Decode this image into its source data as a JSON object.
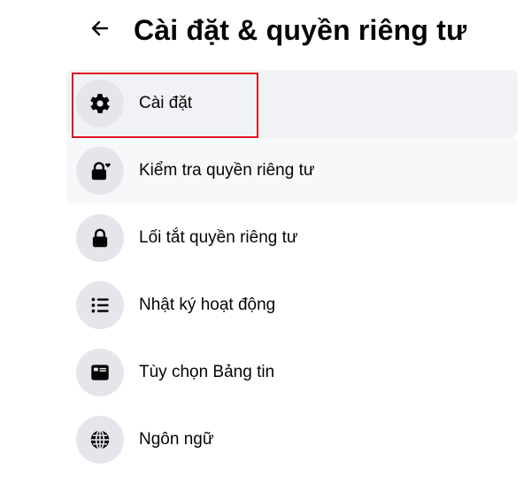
{
  "header": {
    "back_icon": "arrow-left-icon",
    "title": "Cài đặt & quyền riêng tư"
  },
  "menu": {
    "items": [
      {
        "label": "Cài đặt",
        "icon": "gear-icon"
      },
      {
        "label": "Kiểm tra quyền riêng tư",
        "icon": "lock-heart-icon"
      },
      {
        "label": "Lối tắt quyền riêng tư",
        "icon": "lock-icon"
      },
      {
        "label": "Nhật ký hoạt động",
        "icon": "list-icon"
      },
      {
        "label": "Tùy chọn Bảng tin",
        "icon": "news-feed-icon"
      },
      {
        "label": "Ngôn ngữ",
        "icon": "globe-icon"
      }
    ]
  },
  "colors": {
    "highlight_border": "#e0141e",
    "icon_background": "#e4e6eb",
    "item_highlight": "#f0f2f5"
  }
}
